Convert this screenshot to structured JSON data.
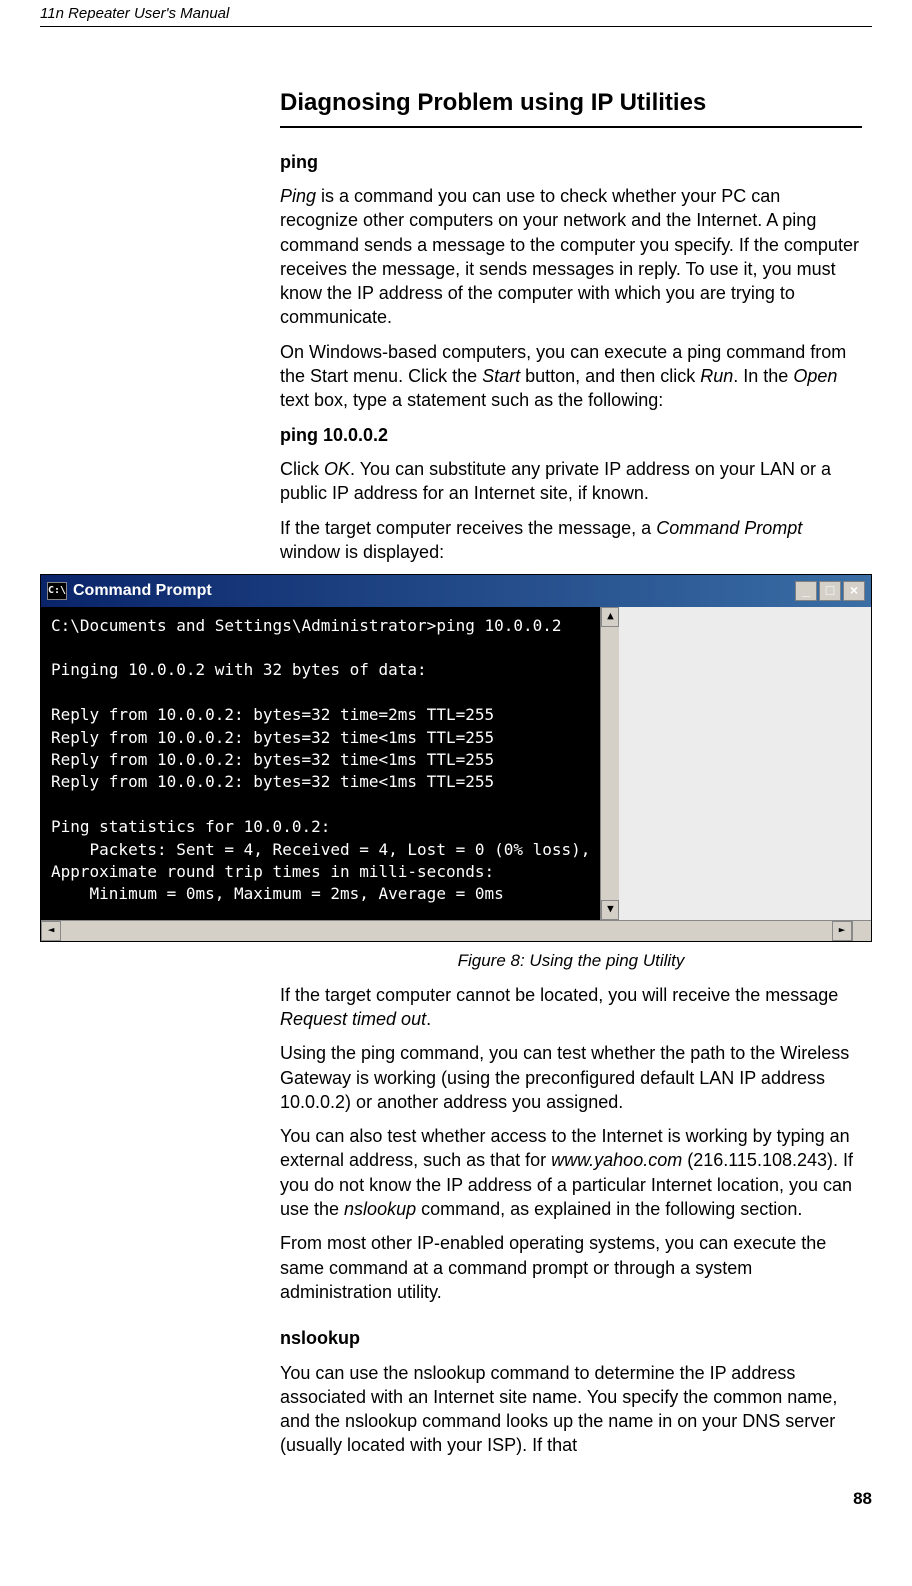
{
  "header": "11n Repeater User's Manual",
  "section_title": "Diagnosing Problem using IP Utilities",
  "ping_title": "ping",
  "ping_para1_pre": "Ping",
  "ping_para1_post": " is a command you can use to check whether your PC can recognize other computers on your network and the Internet. A ping command sends a message to the computer you specify. If the computer receives the message, it sends messages in reply. To use it, you must know the IP address of the computer with which you are trying to communicate.",
  "ping_para2_a": "On Windows-based computers, you can execute a ping command from the Start menu. Click the ",
  "ping_para2_start": "Start",
  "ping_para2_b": " button, and then click ",
  "ping_para2_run": "Run",
  "ping_para2_c": ". In the ",
  "ping_para2_open": "Open",
  "ping_para2_d": " text box, type a statement such as the following:",
  "ping_cmd": "ping 10.0.0.2",
  "ping_para3_a": "Click ",
  "ping_para3_ok": "OK",
  "ping_para3_b": ". You can substitute any private IP address on your LAN or a public IP address for an Internet site, if known.",
  "ping_para4_a": "If the target computer receives the message, a ",
  "ping_para4_cp": "Command Prompt",
  "ping_para4_b": " window is displayed:",
  "cmd_title": "Command Prompt",
  "cmd_body": "C:\\Documents and Settings\\Administrator>ping 10.0.0.2\n\nPinging 10.0.0.2 with 32 bytes of data:\n\nReply from 10.0.0.2: bytes=32 time=2ms TTL=255\nReply from 10.0.0.2: bytes=32 time<1ms TTL=255\nReply from 10.0.0.2: bytes=32 time<1ms TTL=255\nReply from 10.0.0.2: bytes=32 time<1ms TTL=255\n\nPing statistics for 10.0.0.2:\n    Packets: Sent = 4, Received = 4, Lost = 0 (0% loss),\nApproximate round trip times in milli-seconds:\n    Minimum = 0ms, Maximum = 2ms, Average = 0ms",
  "figure_caption": "Figure 8:          Using the ping Utility",
  "post_para1_a": "If the target computer cannot be located, you will receive the message ",
  "post_para1_req": "Request timed out",
  "post_para1_b": ".",
  "post_para2": "Using the ping command, you can test whether the path to the Wireless Gateway is working (using the preconfigured default LAN IP address 10.0.0.2) or another address you assigned.",
  "post_para3_a": "You can also test whether access to the Internet is working by typing an external address, such as that for ",
  "post_para3_yahoo": "www.yahoo.com",
  "post_para3_b": " (216.115.108.243). If you do not know the IP address of a particular Internet location, you can use the ",
  "post_para3_ns": "nslookup",
  "post_para3_c": " command, as explained in the following section.",
  "post_para4": "From most other IP-enabled operating systems, you can execute the same command at a command prompt or through a system administration utility.",
  "nslookup_title": "nslookup",
  "nslookup_para": "You can use the nslookup command to determine the IP address associated with an Internet site name. You specify the common name, and the nslookup command looks up the name in on your DNS server (usually located with your ISP). If that",
  "page_number": "88",
  "win_min": "_",
  "win_max": "□",
  "win_close": "×",
  "arrow_up": "▲",
  "arrow_down": "▼",
  "arrow_left": "◄",
  "arrow_right": "►",
  "cmd_icon_label": "C:\\"
}
